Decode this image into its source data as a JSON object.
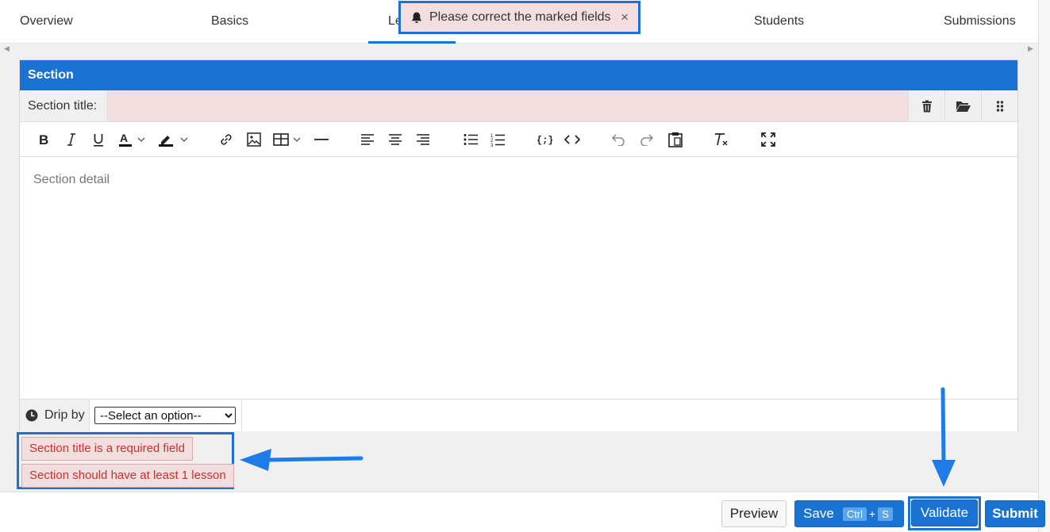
{
  "tabs": {
    "overview": "Overview",
    "basics": "Basics",
    "lessons_partial": "Le",
    "students": "Students",
    "submissions": "Submissions"
  },
  "toast": {
    "message": "Please correct the marked fields",
    "close": "×"
  },
  "section": {
    "header": "Section",
    "title_label": "Section title:",
    "title_value": "",
    "editor_placeholder": "Section detail",
    "drip_label": "Drip by",
    "drip_selected": "--Select an option--"
  },
  "errors": [
    "Section title is a required field",
    "Section should have at least 1 lesson"
  ],
  "footer": {
    "preview": "Preview",
    "save": "Save",
    "kbd_ctrl": "Ctrl",
    "kbd_plus": "+",
    "kbd_s": "S",
    "validate": "Validate",
    "submit": "Submit"
  },
  "colors": {
    "accent": "#1a73d2",
    "error_bg": "#f2dedf",
    "error_text": "#c9302c"
  }
}
